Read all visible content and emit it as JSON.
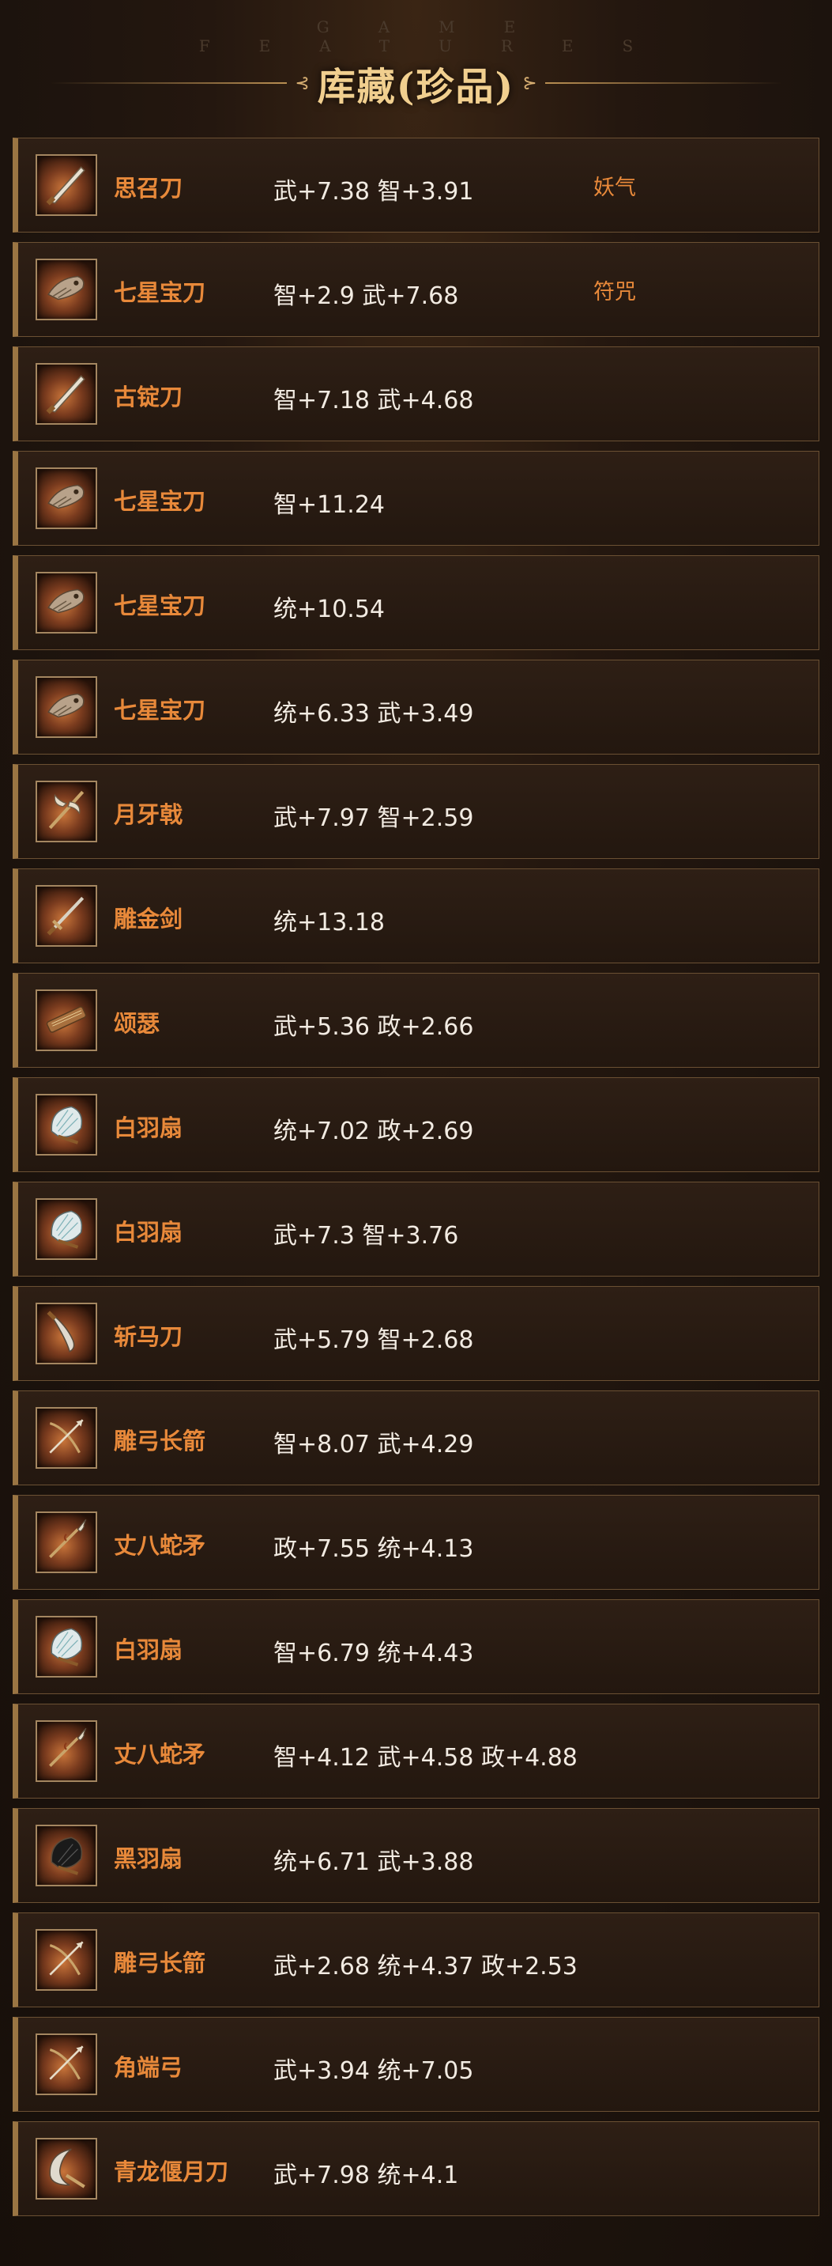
{
  "header": {
    "subtitle": "GAME FEATURES",
    "title": "库藏(珍品)",
    "ornament_left": "⊰",
    "ornament_right": "⊱"
  },
  "items": [
    {
      "name": "思召刀",
      "stats": "武+7.38 智+3.91",
      "special": "妖气",
      "icon": "dao-icon"
    },
    {
      "name": "七星宝刀",
      "stats": "智+2.9 武+7.68",
      "special": "符咒",
      "icon": "dragon-blade-icon"
    },
    {
      "name": "古锭刀",
      "stats": "智+7.18 武+4.68",
      "special": "",
      "icon": "dao-icon"
    },
    {
      "name": "七星宝刀",
      "stats": "智+11.24",
      "special": "",
      "icon": "dragon-blade-icon"
    },
    {
      "name": "七星宝刀",
      "stats": "统+10.54",
      "special": "",
      "icon": "dragon-blade-icon"
    },
    {
      "name": "七星宝刀",
      "stats": "统+6.33 武+3.49",
      "special": "",
      "icon": "dragon-blade-icon"
    },
    {
      "name": "月牙戟",
      "stats": "武+7.97 智+2.59",
      "special": "",
      "icon": "halberd-icon"
    },
    {
      "name": "雕金剑",
      "stats": "统+13.18",
      "special": "",
      "icon": "sword-icon"
    },
    {
      "name": "颂瑟",
      "stats": "武+5.36 政+2.66",
      "special": "",
      "icon": "zither-icon"
    },
    {
      "name": "白羽扇",
      "stats": "统+7.02 政+2.69",
      "special": "",
      "icon": "feather-fan-icon"
    },
    {
      "name": "白羽扇",
      "stats": "武+7.3 智+3.76",
      "special": "",
      "icon": "feather-fan-icon"
    },
    {
      "name": "斩马刀",
      "stats": "武+5.79 智+2.68",
      "special": "",
      "icon": "curved-blade-icon"
    },
    {
      "name": "雕弓长箭",
      "stats": "智+8.07 武+4.29",
      "special": "",
      "icon": "bow-arrow-icon"
    },
    {
      "name": "丈八蛇矛",
      "stats": "政+7.55 统+4.13",
      "special": "",
      "icon": "serpent-spear-icon"
    },
    {
      "name": "白羽扇",
      "stats": "智+6.79 统+4.43",
      "special": "",
      "icon": "feather-fan-icon"
    },
    {
      "name": "丈八蛇矛",
      "stats": "智+4.12 武+4.58 政+4.88",
      "special": "",
      "icon": "serpent-spear-icon"
    },
    {
      "name": "黑羽扇",
      "stats": "统+6.71 武+3.88",
      "special": "",
      "icon": "black-fan-icon"
    },
    {
      "name": "雕弓长箭",
      "stats": "武+2.68 统+4.37 政+2.53",
      "special": "",
      "icon": "bow-arrow-icon"
    },
    {
      "name": "角端弓",
      "stats": "武+3.94 统+7.05",
      "special": "",
      "icon": "bow-arrow-icon"
    },
    {
      "name": "青龙偃月刀",
      "stats": "武+7.98 统+4.1",
      "special": "",
      "icon": "crescent-blade-icon"
    }
  ]
}
